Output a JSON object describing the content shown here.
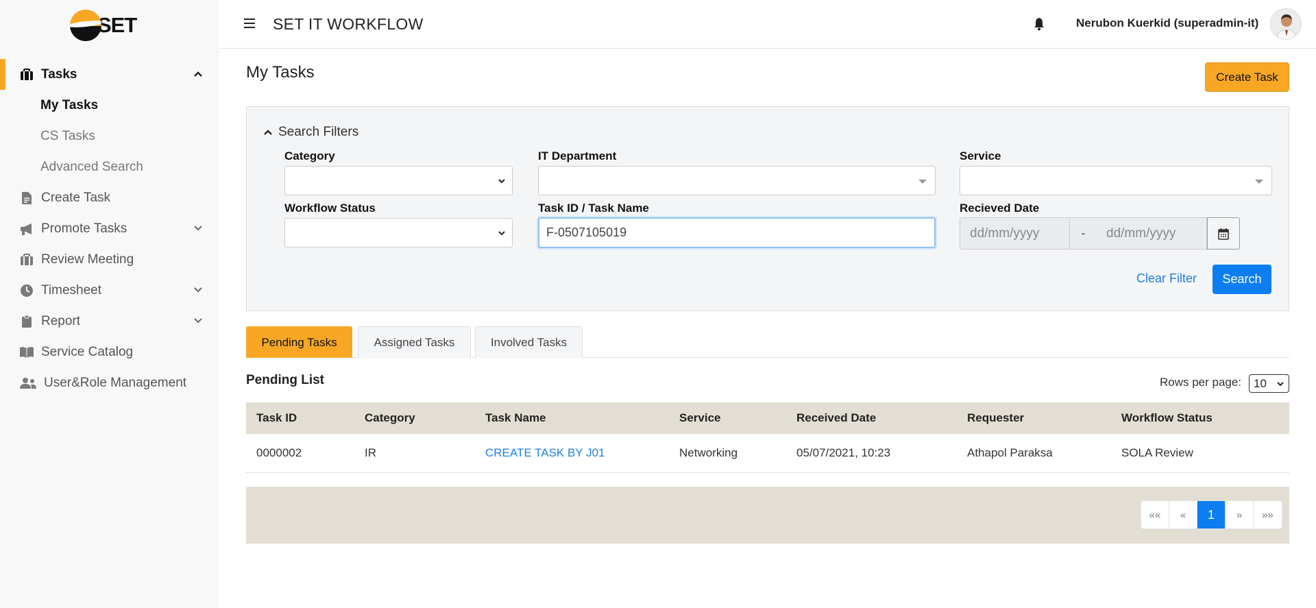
{
  "logo": {
    "text": "SET"
  },
  "sidebar": {
    "items": [
      {
        "label": "Tasks",
        "icon": "briefcase-icon",
        "active": true,
        "expanded": true,
        "children": [
          {
            "label": "My Tasks",
            "current": true
          },
          {
            "label": "CS Tasks"
          },
          {
            "label": "Advanced Search"
          }
        ]
      },
      {
        "label": "Create Task",
        "icon": "file-icon"
      },
      {
        "label": "Promote Tasks",
        "icon": "megaphone-icon",
        "has_children": true
      },
      {
        "label": "Review Meeting",
        "icon": "briefcase-icon"
      },
      {
        "label": "Timesheet",
        "icon": "clock-icon",
        "has_children": true
      },
      {
        "label": "Report",
        "icon": "clipboard-icon",
        "has_children": true
      },
      {
        "label": "Service Catalog",
        "icon": "book-icon"
      },
      {
        "label": "User&Role Management",
        "icon": "users-icon"
      }
    ]
  },
  "header": {
    "title": "SET IT WORKFLOW",
    "user": "Nerubon Kuerkid (superadmin-it)"
  },
  "main": {
    "page_title": "My Tasks",
    "create_button": "Create Task",
    "filters": {
      "toggle_label": "Search Filters",
      "category_label": "Category",
      "it_department_label": "IT Department",
      "service_label": "Service",
      "workflow_status_label": "Workflow Status",
      "task_label": "Task ID / Task Name",
      "task_value": "F-0507105019",
      "received_date_label": "Recieved Date",
      "date_from_placeholder": "dd/mm/yyyy",
      "date_separator": "-",
      "date_to_placeholder": "dd/mm/yyyy",
      "clear_label": "Clear Filter",
      "search_label": "Search"
    },
    "tabs": [
      {
        "label": "Pending Tasks",
        "active": true
      },
      {
        "label": "Assigned Tasks"
      },
      {
        "label": "Involved Tasks"
      }
    ],
    "list": {
      "title": "Pending List",
      "rows_per_page_label": "Rows per page:",
      "rows_per_page_value": "10",
      "columns": [
        "Task ID",
        "Category",
        "Task Name",
        "Service",
        "Received Date",
        "Requester",
        "Workflow Status"
      ],
      "rows": [
        [
          "0000002",
          "IR",
          "CREATE TASK BY J01",
          "Networking",
          "05/07/2021, 10:23",
          "Athapol Paraksa",
          "SOLA Review"
        ]
      ]
    },
    "pagination": {
      "first": "««",
      "prev": "«",
      "current": "1",
      "next": "»",
      "last": "»»"
    }
  },
  "colors": {
    "accent": "#f7a724",
    "primary": "#0d7ef2",
    "link": "#1f7fe0",
    "table_header": "#e3ded3"
  }
}
